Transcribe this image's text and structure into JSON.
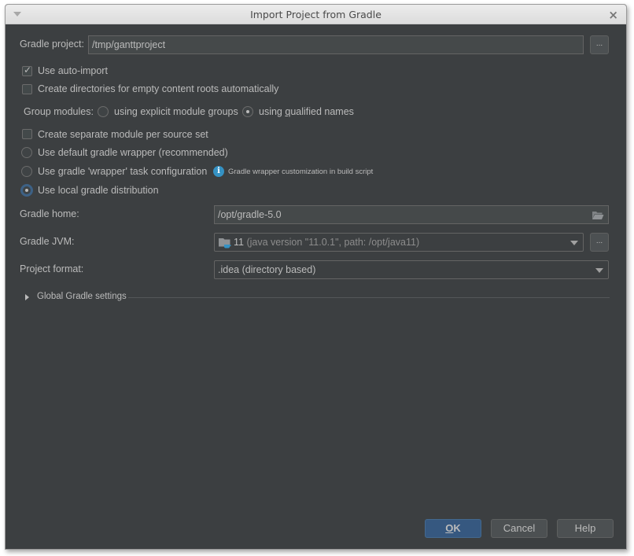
{
  "window": {
    "title": "Import Project from Gradle",
    "close_symbol": "×"
  },
  "gradle_project": {
    "label": "Gradle project:",
    "value": "/tmp/ganttproject",
    "browse_label": "..."
  },
  "options": {
    "auto_import": {
      "label": "Use auto-import",
      "checked": true
    },
    "create_dirs": {
      "label": "Create directories for empty content roots automatically",
      "checked": false
    },
    "group_modules": {
      "label": "Group modules:",
      "choices": [
        {
          "label": "using explicit module groups",
          "selected": false
        },
        {
          "label_pre": "using ",
          "label_mnemonic": "q",
          "label_post": "ualified names",
          "selected": true
        }
      ]
    },
    "separate_module": {
      "label": "Create separate module per source set",
      "checked": false
    },
    "distribution": [
      {
        "label": "Use default gradle wrapper (recommended)",
        "selected": false
      },
      {
        "label": "Use gradle 'wrapper' task configuration",
        "selected": false,
        "hint": "Gradle wrapper customization in build script"
      },
      {
        "label": "Use local gradle distribution",
        "selected": true
      }
    ]
  },
  "gradle_home": {
    "label": "Gradle home:",
    "value": "/opt/gradle-5.0"
  },
  "gradle_jvm": {
    "label": "Gradle JVM:",
    "version": "11",
    "detail": "(java version \"11.0.1\", path: /opt/java11)",
    "browse_label": "..."
  },
  "project_format": {
    "label": "Project format:",
    "value": ".idea (directory based)"
  },
  "global_settings": {
    "label": "Global Gradle settings",
    "expanded": false
  },
  "buttons": {
    "ok_mnemonic": "O",
    "ok_rest": "K",
    "cancel": "Cancel",
    "help": "Help"
  },
  "colors": {
    "background": "#3c3f41",
    "accent_button": "#365880",
    "info_icon": "#3592c4",
    "focus_ring": "#3d6185"
  }
}
